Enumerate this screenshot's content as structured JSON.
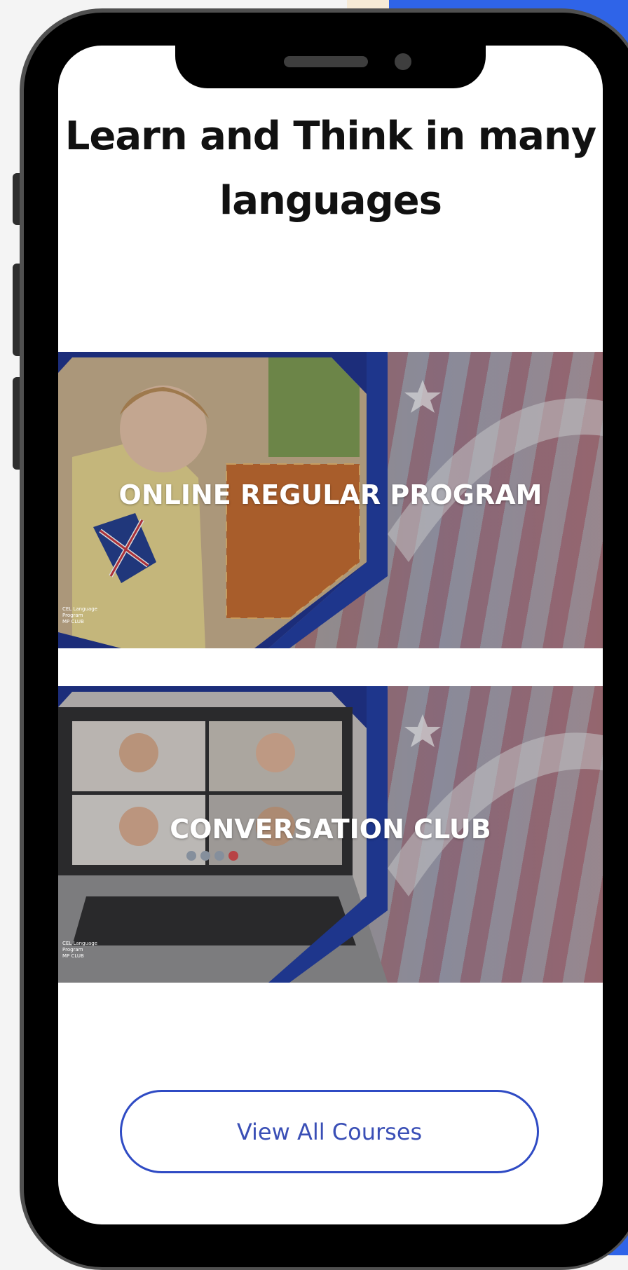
{
  "page": {
    "title": "Learn and Think in many languages"
  },
  "banners": [
    {
      "label": "ONLINE REGULAR PROGRAM",
      "logo_lines": [
        "CEL Language",
        "Program",
        "MP CLUB"
      ]
    },
    {
      "label": "CONVERSATION CLUB",
      "logo_lines": [
        "CEL Language",
        "Program",
        "MP CLUB"
      ]
    }
  ],
  "cta": {
    "label": "View All Courses"
  },
  "colors": {
    "accent_blue": "#2f4bc4",
    "background_blue": "#2f64e8",
    "phone_frame": "#000000"
  }
}
